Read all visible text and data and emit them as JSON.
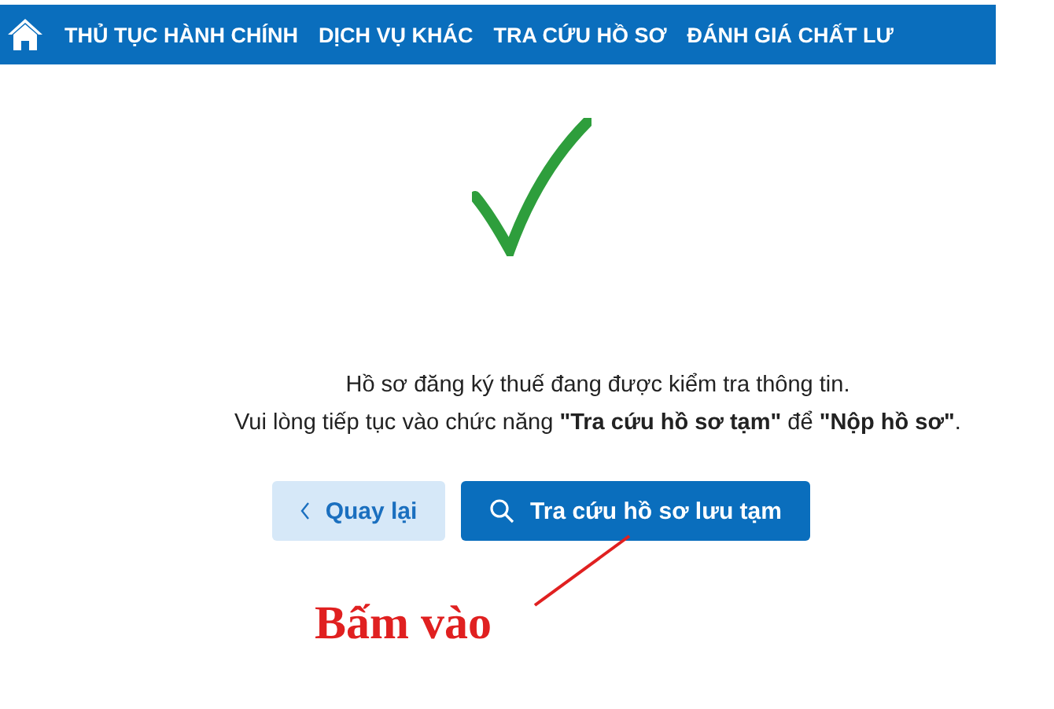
{
  "nav": {
    "items": [
      "THỦ TỤC HÀNH CHÍNH",
      "DỊCH VỤ KHÁC",
      "TRA CỨU HỒ SƠ",
      "ĐÁNH GIÁ CHẤT LƯ"
    ]
  },
  "message": [
    "Hồ sơ đăng ký thuế đang được kiểm tra thông tin.",
    "Vui lòng tiếp tục vào chức năng **\"Tra cứu hồ sơ tạm\"** để **\"Nộp hồ sơ\"**."
  ],
  "buttons": [
    {
      "label": "Quay lại",
      "kind": "back"
    },
    {
      "label": "Tra cứu hồ sơ lưu tạm",
      "kind": "search"
    }
  ],
  "annotation": {
    "text": "Bấm vào"
  }
}
